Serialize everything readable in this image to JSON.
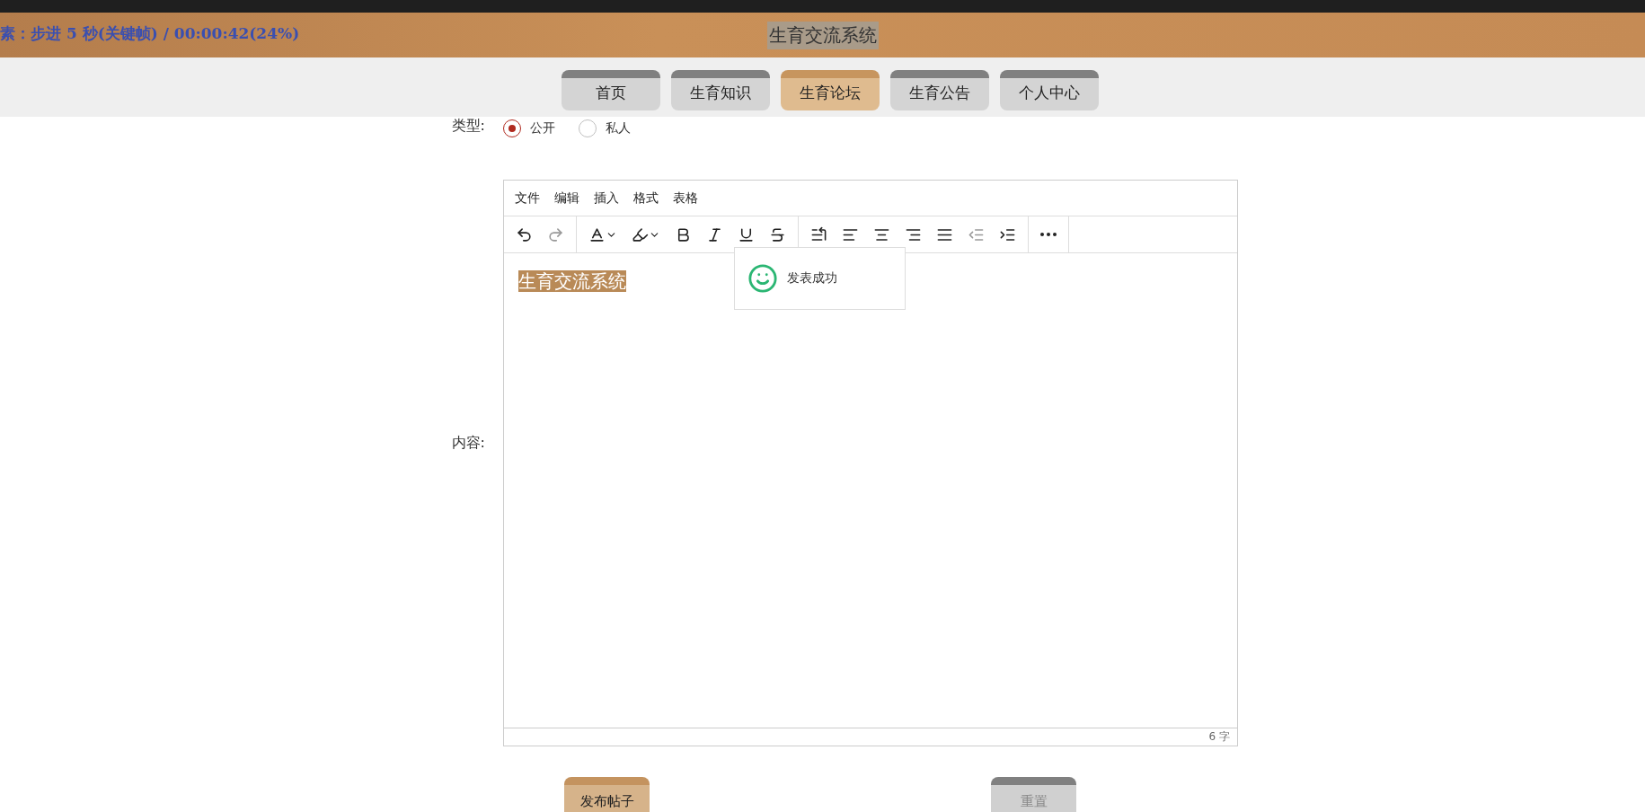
{
  "player_overlay": {
    "text": "素：步进 5 秒(关键帧) / 00:00:42(24%)"
  },
  "header": {
    "title": "生育交流系统"
  },
  "nav": [
    {
      "label": "首页",
      "selected": false
    },
    {
      "label": "生育知识",
      "selected": false
    },
    {
      "label": "生育论坛",
      "selected": true
    },
    {
      "label": "生育公告",
      "selected": false
    },
    {
      "label": "个人中心",
      "selected": false
    }
  ],
  "form": {
    "type_label": "类型:",
    "type_options": [
      {
        "label": "公开",
        "selected": true
      },
      {
        "label": "私人",
        "selected": false
      }
    ],
    "content_label": "内容:",
    "editor": {
      "menu": [
        "文件",
        "编辑",
        "插入",
        "格式",
        "表格"
      ],
      "toolbar": [
        [
          {
            "kind": "undo",
            "disabled": false
          },
          {
            "kind": "redo",
            "disabled": true
          }
        ],
        [
          {
            "kind": "text-color",
            "disabled": false
          },
          {
            "kind": "highlight",
            "disabled": false
          },
          {
            "kind": "bold",
            "disabled": false
          },
          {
            "kind": "italic",
            "disabled": false
          },
          {
            "kind": "underline",
            "disabled": false
          },
          {
            "kind": "strike",
            "disabled": false
          }
        ],
        [
          {
            "kind": "line-height",
            "disabled": false
          },
          {
            "kind": "align-left",
            "disabled": false
          },
          {
            "kind": "align-center",
            "disabled": false
          },
          {
            "kind": "align-right",
            "disabled": false
          },
          {
            "kind": "justify",
            "disabled": false
          },
          {
            "kind": "outdent",
            "disabled": true
          },
          {
            "kind": "indent",
            "disabled": false
          }
        ],
        [
          {
            "kind": "more",
            "disabled": false
          }
        ]
      ],
      "content": "生育交流系统",
      "word_count": "6 字"
    },
    "buttons": [
      {
        "label": "发布帖子",
        "kind": "primary"
      },
      {
        "label": "重置",
        "kind": "secondary"
      }
    ]
  },
  "toast": {
    "message": "发表成功"
  }
}
